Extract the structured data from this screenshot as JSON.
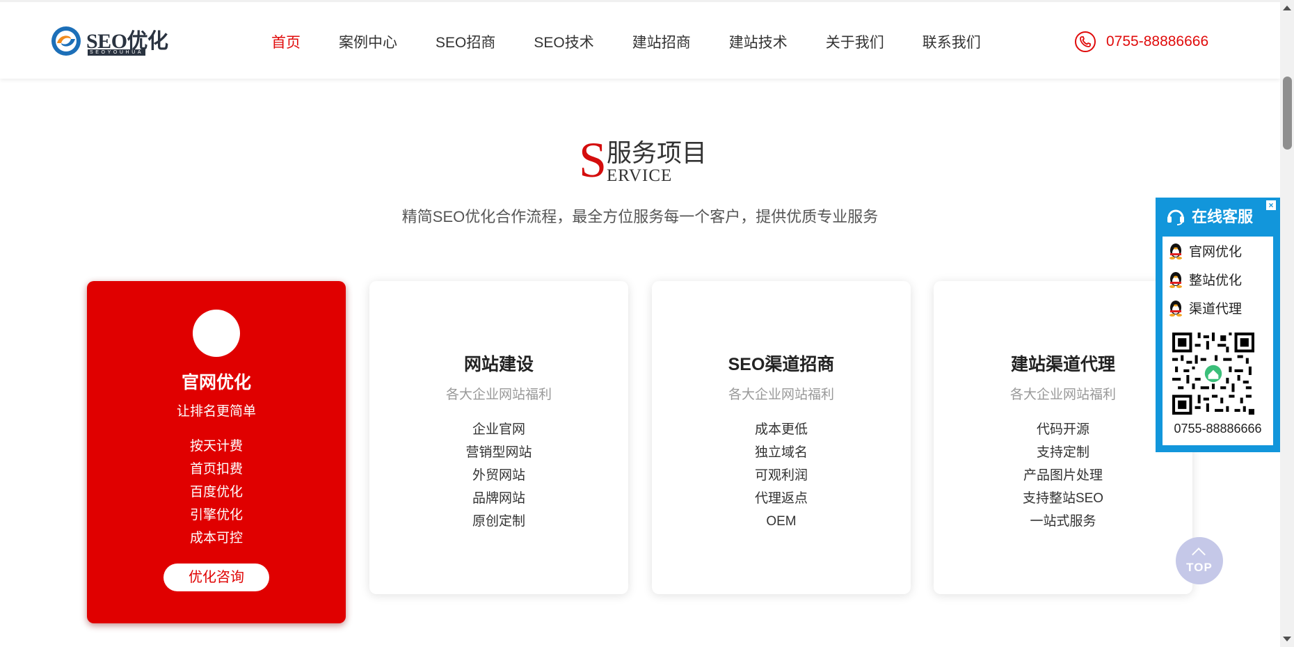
{
  "header": {
    "logo_text": "SEO优化",
    "logo_sub": "SEOYOUHUA",
    "nav": [
      {
        "label": "首页",
        "active": true
      },
      {
        "label": "案例中心"
      },
      {
        "label": "SEO招商"
      },
      {
        "label": "SEO技术"
      },
      {
        "label": "建站招商"
      },
      {
        "label": "建站技术"
      },
      {
        "label": "关于我们"
      },
      {
        "label": "联系我们"
      }
    ],
    "phone": "0755-88886666"
  },
  "section": {
    "title_letter": "S",
    "title_cn": "服务项目",
    "title_en": "ERVICE",
    "desc": "精简SEO优化合作流程，最全方位服务每一个客户，提供优质专业服务"
  },
  "cards": [
    {
      "title": "官网优化",
      "sub": "让排名更简单",
      "items": [
        "按天计费",
        "首页扣费",
        "百度优化",
        "引擎优化",
        "成本可控"
      ],
      "button": "优化咨询"
    },
    {
      "title": "网站建设",
      "sub": "各大企业网站福利",
      "items": [
        "企业官网",
        "营销型网站",
        "外贸网站",
        "品牌网站",
        "原创定制"
      ]
    },
    {
      "title": "SEO渠道招商",
      "sub": "各大企业网站福利",
      "items": [
        "成本更低",
        "独立域名",
        "可观利润",
        "代理返点",
        "OEM"
      ]
    },
    {
      "title": "建站渠道代理",
      "sub": "各大企业网站福利",
      "items": [
        "代码开源",
        "支持定制",
        "产品图片处理",
        "支持整站SEO",
        "一站式服务"
      ]
    }
  ],
  "online_service": {
    "title": "在线客服",
    "close": "×",
    "items": [
      "官网优化",
      "整站优化",
      "渠道代理"
    ],
    "phone": "0755-88886666"
  },
  "totop": {
    "label": "TOP"
  },
  "colors": {
    "accent": "#e00000",
    "service_blue": "#1296db",
    "text": "#333333"
  }
}
